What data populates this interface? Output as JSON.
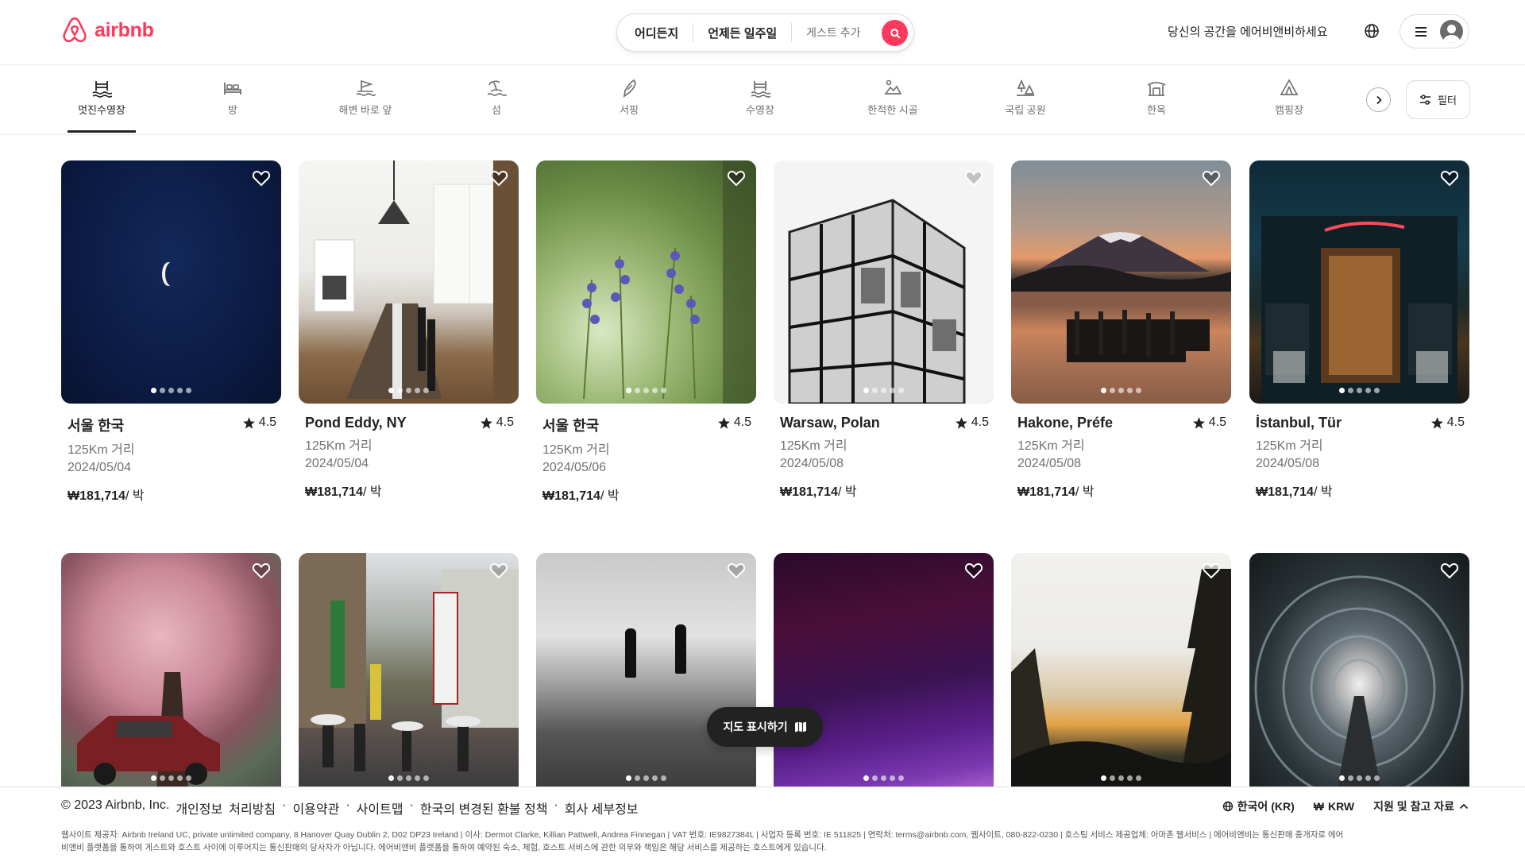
{
  "header": {
    "logo_text": "airbnb",
    "search": {
      "where": "어디든지",
      "when": "언제든 일주일",
      "guests": "게스트 추가"
    },
    "host_link": "당신의 공간을 에어비앤비하세요"
  },
  "categories": [
    {
      "label": "멋진수영장",
      "icon": "pool-icon",
      "active": true
    },
    {
      "label": "방",
      "icon": "bed-icon"
    },
    {
      "label": "해변 바로 앞",
      "icon": "beachfront-icon"
    },
    {
      "label": "섬",
      "icon": "island-icon"
    },
    {
      "label": "서핑",
      "icon": "surfboard-icon"
    },
    {
      "label": "수영장",
      "icon": "pool-icon"
    },
    {
      "label": "한적한 시골",
      "icon": "countryside-icon"
    },
    {
      "label": "국립 공원",
      "icon": "national-park-icon"
    },
    {
      "label": "한옥",
      "icon": "hanok-icon"
    },
    {
      "label": "캠핑장",
      "icon": "camping-icon"
    }
  ],
  "filter_label": "필터",
  "listings": [
    {
      "location": "서울 한국",
      "rating": "4.5",
      "distance": "125Km 거리",
      "date": "2024/05/04",
      "price": "₩181,714",
      "per": "/ 박"
    },
    {
      "location": "Pond Eddy, NY",
      "rating": "4.5",
      "distance": "125Km 거리",
      "date": "2024/05/04",
      "price": "₩181,714",
      "per": "/ 박"
    },
    {
      "location": "서울 한국",
      "rating": "4.5",
      "distance": "125Km 거리",
      "date": "2024/05/06",
      "price": "₩181,714",
      "per": "/ 박"
    },
    {
      "location": "Warsaw, Polan",
      "rating": "4.5",
      "distance": "125Km 거리",
      "date": "2024/05/08",
      "price": "₩181,714",
      "per": "/ 박"
    },
    {
      "location": "Hakone, Préfe",
      "rating": "4.5",
      "distance": "125Km 거리",
      "date": "2024/05/08",
      "price": "₩181,714",
      "per": "/ 박"
    },
    {
      "location": "İstanbul, Tür",
      "rating": "4.5",
      "distance": "125Km 거리",
      "date": "2024/05/08",
      "price": "₩181,714",
      "per": "/ 박"
    }
  ],
  "map_button": "지도 표시하기",
  "footer": {
    "copyright": "© 2023 Airbnb, Inc.",
    "links": [
      "개인정보",
      "처리방침",
      "이용약관",
      "사이트맵",
      "한국의 변경된 환불 정책",
      "회사 세부정보"
    ],
    "language": "한국어 (KR)",
    "currency_symbol": "₩",
    "currency": "KRW",
    "support": "지원 및 참고 자료",
    "legal_line1": "웹사이트 제공자: Airbnb Ireland UC, private unlimited company, 8 Hanover Quay Dublin 2, D02 DP23 Ireland | 이사: Dermot Clarke, Killian Pattwell, Andrea Finnegan | VAT 번호: IE9827384L | 사업자 등록 번호: IE 511825 | 연락처: terms@airbnb.com, 웹사이트, 080-822-0230 | 호스팅 서비스 제공업체: 아마존 웹서비스 | 에어비앤비는 통신판매 중개자로 에어",
    "legal_line2": "비앤비 플랫폼을 통하여 게스트와 호스트 사이에 이루어지는 통신판매의 당사자가 아닙니다. 에어비앤비 플랫폼을 통하여 예약된 숙소, 체험, 호스트 서비스에 관한 의무와 책임은 해당 서비스를 제공하는 호스트에게 있습니다."
  },
  "colors": {
    "brand": "#ff385c",
    "text": "#222222",
    "muted": "#717171"
  }
}
